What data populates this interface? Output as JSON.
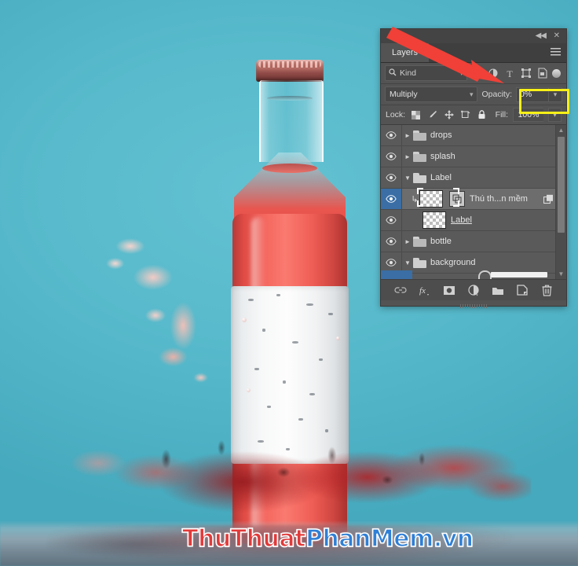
{
  "app": {
    "panel_title": "Layers",
    "panel_menu_icon": "hamburger-menu-icon",
    "collapse_icon": "double-chevron-left-icon",
    "close_icon": "close-x-icon"
  },
  "filter_row": {
    "search_icon": "magnifier-icon",
    "kind_label": "Kind",
    "kind_chevron": "chevron-down-icon",
    "filter_icons": [
      {
        "name": "pixel-layer-filter-icon",
        "title": "Pixel"
      },
      {
        "name": "adjustment-layer-filter-icon",
        "title": "Adjustment"
      },
      {
        "name": "type-layer-filter-icon",
        "title": "Type"
      },
      {
        "name": "shape-layer-filter-icon",
        "title": "Shape"
      },
      {
        "name": "smart-object-filter-icon",
        "title": "Smart Object"
      }
    ],
    "filter_toggle": "filter-enable-toggle"
  },
  "blend_row": {
    "mode_value": "Multiply",
    "mode_chevron": "chevron-down-icon",
    "opacity_label": "Opacity:",
    "opacity_value": "0%",
    "opacity_chevron": "chevron-down-icon",
    "highlight_color": "#f8f018"
  },
  "lock_row": {
    "lock_label": "Lock:",
    "lock_icons": [
      {
        "name": "lock-transparent-pixels-icon"
      },
      {
        "name": "lock-image-pixels-brush-icon"
      },
      {
        "name": "lock-position-move-icon"
      },
      {
        "name": "lock-artboard-nesting-icon"
      },
      {
        "name": "lock-all-padlock-icon"
      }
    ],
    "fill_label": "Fill:",
    "fill_value": "100%",
    "fill_chevron": "chevron-down-icon"
  },
  "layers": [
    {
      "name": "drops",
      "type": "group",
      "expanded": false,
      "visible": true,
      "selected": false,
      "indent": 0,
      "underline": false
    },
    {
      "name": "splash",
      "type": "group",
      "expanded": false,
      "visible": true,
      "selected": false,
      "indent": 0,
      "underline": false
    },
    {
      "name": "Label",
      "type": "group",
      "expanded": true,
      "visible": true,
      "selected": false,
      "indent": 0,
      "underline": false
    },
    {
      "name": "Thú th...n mềm",
      "type": "smart-object",
      "expanded": false,
      "visible": true,
      "selected": true,
      "indent": 1,
      "underline": false
    },
    {
      "name": "Label",
      "type": "pixel",
      "expanded": false,
      "visible": true,
      "selected": false,
      "indent": 1,
      "underline": true
    },
    {
      "name": "bottle",
      "type": "group",
      "expanded": false,
      "visible": true,
      "selected": false,
      "indent": 0,
      "underline": false
    },
    {
      "name": "background",
      "type": "group",
      "expanded": true,
      "visible": true,
      "selected": false,
      "indent": 0,
      "underline": false
    }
  ],
  "scrollbar": {
    "up_arrow": "chevron-up-icon",
    "down_arrow": "chevron-down-icon"
  },
  "footer_icons": [
    {
      "name": "link-layers-icon"
    },
    {
      "name": "layer-style-fx-icon"
    },
    {
      "name": "add-layer-mask-icon"
    },
    {
      "name": "new-adjustment-layer-icon"
    },
    {
      "name": "new-group-icon"
    },
    {
      "name": "new-layer-icon"
    },
    {
      "name": "delete-layer-trash-icon"
    }
  ],
  "annotation": {
    "arrow_color": "#f04037",
    "arrow_name": "red-pointer-arrow"
  },
  "canvas": {
    "background_color": "#55b8ca",
    "bottle_color": "#ef5d55",
    "label_color": "#f7f8f8",
    "watermark_part1": "ThuThuat",
    "watermark_part2": "PhanMem",
    "watermark_part3": ".vn",
    "watermark_color_1": "#e23a3a",
    "watermark_color_2": "#2f7fd6"
  }
}
